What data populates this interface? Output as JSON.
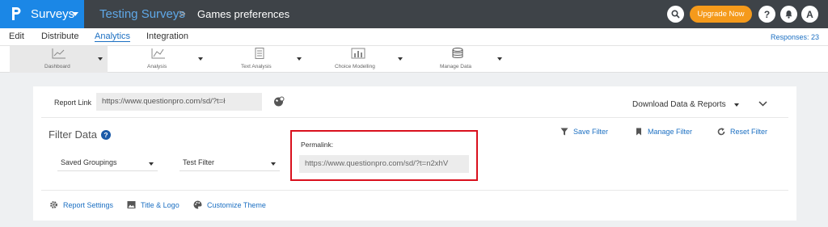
{
  "topbar": {
    "app_name": "Surveys",
    "breadcrumb_parent": "Testing Surveys",
    "breadcrumb_separator": ">",
    "breadcrumb_current": "Games preferences",
    "upgrade_label": "Upgrade Now",
    "help_label": "?",
    "user_initial": "A"
  },
  "subnav": {
    "items": [
      {
        "label": "Edit"
      },
      {
        "label": "Distribute"
      },
      {
        "label": "Analytics"
      },
      {
        "label": "Integration"
      }
    ],
    "responses": "Responses: 23"
  },
  "toolbar": {
    "tools": [
      {
        "label": "Dashboard",
        "icon": "line-chart-icon"
      },
      {
        "label": "Analysis",
        "icon": "line-chart-icon"
      },
      {
        "label": "Text Analysis",
        "icon": "document-icon"
      },
      {
        "label": "Choice Modelling",
        "icon": "bar-chart-icon"
      },
      {
        "label": "Manage Data",
        "icon": "database-icon"
      }
    ]
  },
  "report": {
    "link_label": "Report Link",
    "link_value": "https://www.questionpro.com/sd/?t=ł",
    "download_label": "Download Data & Reports"
  },
  "filter": {
    "title": "Filter Data",
    "saved_groupings": "Saved Groupings",
    "test_filter": "Test Filter",
    "permalink_label": "Permalink:",
    "permalink_value": "https://www.questionpro.com/sd/?t=n2xhV",
    "save_filter": "Save Filter",
    "manage_filter": "Manage Filter",
    "reset_filter": "Reset Filter"
  },
  "footer": {
    "report_settings": "Report Settings",
    "title_logo": "Title & Logo",
    "customize_theme": "Customize Theme"
  },
  "colors": {
    "brand_blue": "#1b87e6",
    "topbar_dark": "#3e4348",
    "upgrade_orange": "#f59a1b",
    "link_blue": "#1b6fc2",
    "highlight_red": "#d9101d"
  }
}
